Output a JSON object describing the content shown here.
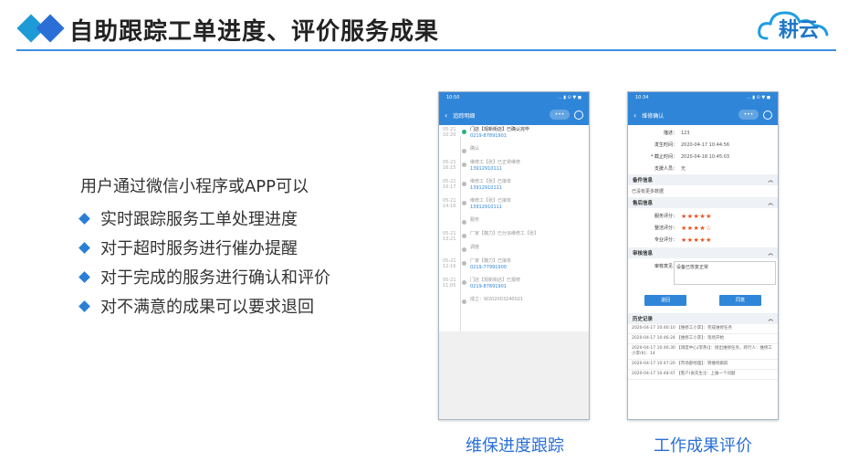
{
  "header": {
    "title": "自助跟踪工单进度、评价服务成果",
    "logo": "耕云"
  },
  "intro": "用户通过微信小程序或APP可以",
  "bullets": [
    "实时跟踪服务工单处理进度",
    "对于超时服务进行催办提醒",
    "对于完成的服务进行确认和评价",
    "对不满意的成果可以要求退回"
  ],
  "phone1": {
    "status_time": "10:50",
    "status_icons": "... ▮ ⊙ ▼ ◼",
    "nav_title": "追踪明细",
    "timeline": [
      {
        "date": "05-21\n10:20",
        "text": "门店【观新街店】已确认完毕",
        "tel": "0219-87891901",
        "active": true
      },
      {
        "date": "",
        "text": "确认",
        "tel": "",
        "active": false
      },
      {
        "date": "05-21\n16:15",
        "text": "维修工【张】已正常维修",
        "tel": "13912910111",
        "active": false
      },
      {
        "date": "05-21\n16:17",
        "text": "维修工【张】已接单",
        "tel": "13912910111",
        "active": false
      },
      {
        "date": "05-21\n14:16",
        "text": "维修工【张】已接单",
        "tel": "13912910111",
        "active": false
      },
      {
        "date": "",
        "text": "服务",
        "tel": "",
        "active": false
      },
      {
        "date": "05-21\n13:21",
        "text": "厂家【魏力】已分派维修工【张】",
        "tel": "",
        "active": false
      },
      {
        "date": "",
        "text": "调度",
        "tel": "",
        "active": false
      },
      {
        "date": "05-21\n12:16",
        "text": "厂家【魏力】已接单",
        "tel": "0219-77991900",
        "active": false
      },
      {
        "date": "05-21\n11:05",
        "text": "门店【观新街店】已报修",
        "tel": "0219-87891901",
        "active": false
      },
      {
        "date": "",
        "text": "成立：W202003240021",
        "tel": "",
        "active": false
      }
    ]
  },
  "phone2": {
    "status_time": "10:34",
    "status_icons": "... ▮ ⊙ ▼ ◼",
    "nav_title": "维修确认",
    "fields": [
      {
        "label": "描述：",
        "value": "123"
      },
      {
        "label": "发生时间：",
        "value": "2020-04-17 10:44:56"
      },
      {
        "label": "* 截止时间：",
        "value": "2020-04-18 10:45:03"
      },
      {
        "label": "支援人员：",
        "value": "无"
      }
    ],
    "sec_parts": "备件信息",
    "parts_note": "已没有更多数据",
    "sec_after": "售后信息",
    "ratings": [
      {
        "label": "服务评分：",
        "stars": "★★★★★"
      },
      {
        "label": "整洁评分：",
        "stars": "★★★★☆"
      },
      {
        "label": "专业评分：",
        "stars": "★★★★★"
      }
    ],
    "sec_review": "审核信息",
    "review_label": "审核意见：",
    "review_value": "设备已恢复正常",
    "btn_return": "退回",
    "btn_confirm": "同意",
    "sec_history": "历史记录",
    "history": [
      "2020-04-17 10:46:10 【维修工小李】：完成维修任务",
      "2020-04-17 10:46:24 【维修工小李】：现场开始",
      "2020-04-17 10:46:30 【调度中心(李燕)】：接出维修任务，跨行人：维修工小李(K)：14",
      "2020-04-17 10:47:20 【市场部经理】：转维修跟踪",
      "2020-04-17 10:48:47 【客户(张先生)】：上报一个问题"
    ]
  },
  "captions": {
    "left": "维保进度跟踪",
    "right": "工作成果评价"
  },
  "colors": {
    "accent": "#2a6fd6",
    "app_bar": "#2f86d9",
    "star": "#e8511f"
  }
}
